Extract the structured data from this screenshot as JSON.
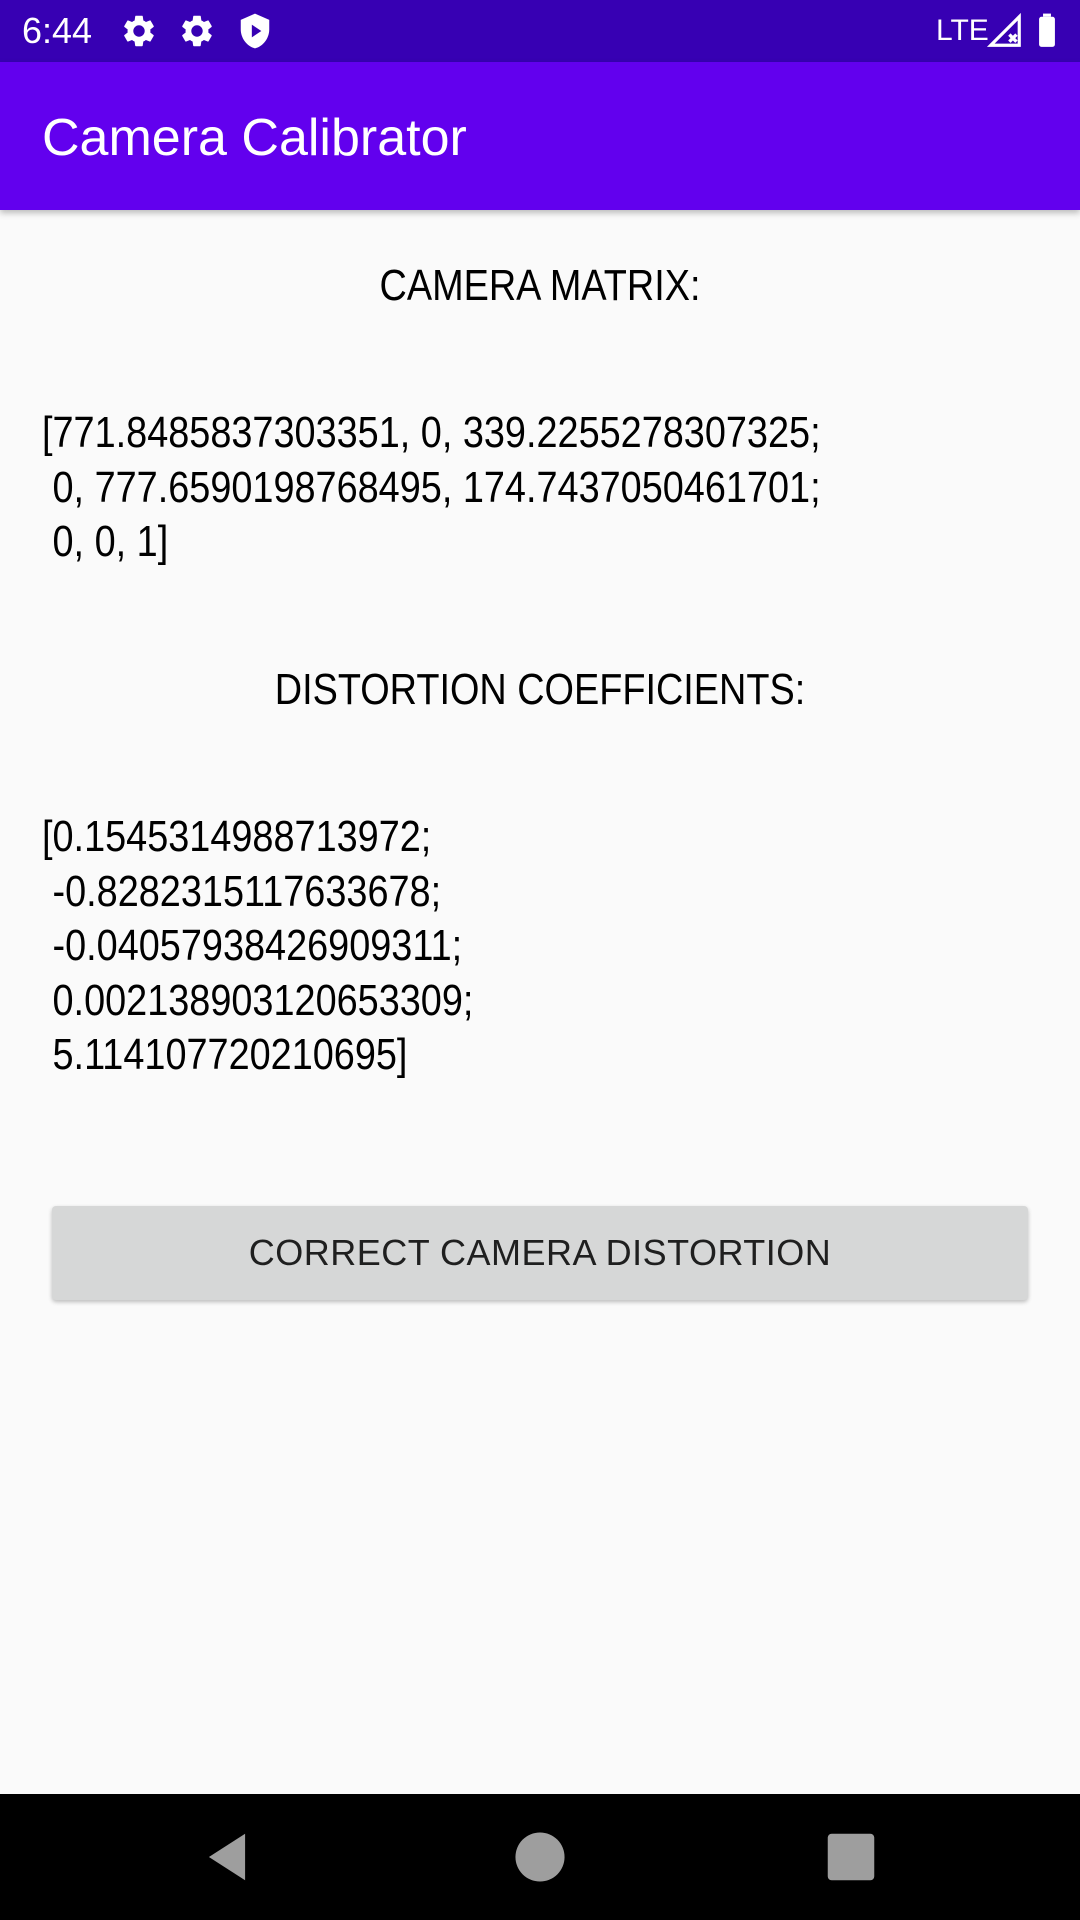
{
  "status_bar": {
    "time": "6:44",
    "network": "LTE",
    "icons": [
      "settings-icon",
      "settings-icon",
      "shield-play-icon",
      "signal-icon",
      "battery-icon"
    ],
    "background": "#3700b3"
  },
  "app_bar": {
    "title": "Camera Calibrator",
    "background": "#6200ee"
  },
  "camera_matrix": {
    "heading": "CAMERA MATRIX:",
    "value": "[771.8485837303351, 0, 339.2255278307325;\n 0, 777.6590198768495, 174.7437050461701;\n 0, 0, 1]"
  },
  "distortion": {
    "heading": "DISTORTION COEFFICIENTS:",
    "value": "[0.1545314988713972;\n -0.8282315117633678;\n -0.04057938426909311;\n 0.002138903120653309;\n 5.114107720210695]"
  },
  "actions": {
    "correct_label": "CORRECT CAMERA DISTORTION"
  },
  "nav_bar": {
    "icons": [
      "back-icon",
      "home-icon",
      "recents-icon"
    ]
  }
}
